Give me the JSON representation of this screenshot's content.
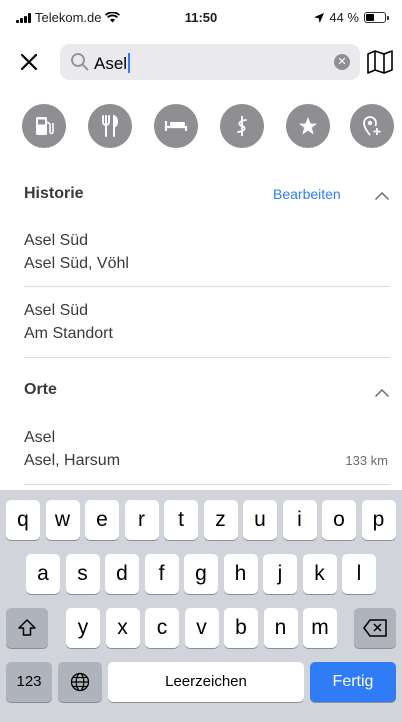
{
  "status": {
    "carrier": "Telekom.de",
    "time": "11:50",
    "battery": "44 %",
    "battery_level": 0.44
  },
  "search": {
    "value": "Asel"
  },
  "categories": [
    {
      "icon": "gas-station-icon"
    },
    {
      "icon": "fork-knife-icon"
    },
    {
      "icon": "bed-icon"
    },
    {
      "icon": "medical-icon"
    },
    {
      "icon": "star-icon"
    },
    {
      "icon": "add-location-icon"
    }
  ],
  "history": {
    "title": "Historie",
    "edit": "Bearbeiten",
    "items": [
      {
        "line1": "Asel Süd",
        "line2": "Asel Süd, Vöhl"
      },
      {
        "line1": "Asel Süd",
        "line2": "Am Standort"
      }
    ]
  },
  "places": {
    "title": "Orte",
    "items": [
      {
        "line1": "Asel",
        "line2": "Asel, Harsum",
        "distance": "133 km"
      }
    ]
  },
  "keyboard": {
    "row1": [
      "q",
      "w",
      "e",
      "r",
      "t",
      "z",
      "u",
      "i",
      "o",
      "p"
    ],
    "row2": [
      "a",
      "s",
      "d",
      "f",
      "g",
      "h",
      "j",
      "k",
      "l"
    ],
    "row3": [
      "y",
      "x",
      "c",
      "v",
      "b",
      "n",
      "m"
    ],
    "numbers": "123",
    "space": "Leerzeichen",
    "done": "Fertig"
  }
}
